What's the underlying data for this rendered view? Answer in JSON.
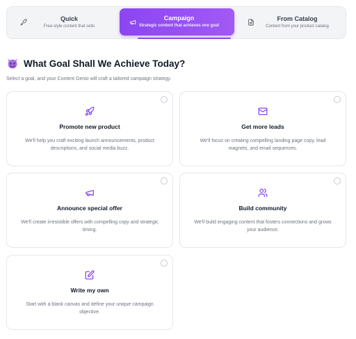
{
  "tabs": {
    "quick": {
      "title": "Quick",
      "subtitle": "Free-style content that sells",
      "icon": "rocket-icon"
    },
    "campaign": {
      "title": "Campaign",
      "subtitle": "Strategic content that achieves one goal",
      "icon": "megaphone-icon",
      "active": true
    },
    "catalog": {
      "title": "From Catalog",
      "subtitle": "Content from your product catalog",
      "icon": "document-icon"
    }
  },
  "heading": {
    "emoji": "smiling-devil-emoji",
    "title": "What Goal Shall We Achieve Today?",
    "subtitle": "Select a goal, and your Content Genio will craft a tailored campaign strategy."
  },
  "goals": [
    {
      "icon": "rocket-icon",
      "title": "Promote new product",
      "description": "We'll help you craft exciting launch announcements, product descriptions, and social media buzz.",
      "selected": false
    },
    {
      "icon": "mail-icon",
      "title": "Get more leads",
      "description": "We'll focus on creating compelling landing page copy, lead magnets, and email sequences.",
      "selected": false
    },
    {
      "icon": "megaphone-icon",
      "title": "Announce special offer",
      "description": "We'll create irresistible offers with compelling copy and strategic timing.",
      "selected": false
    },
    {
      "icon": "users-icon",
      "title": "Build community",
      "description": "We'll build engaging content that fosters connections and grows your audience.",
      "selected": false
    },
    {
      "icon": "pencil-square-icon",
      "title": "Write my own",
      "description": "Start with a blank canvas and define your unique campaign objective.",
      "selected": false
    }
  ],
  "colors": {
    "accent": "#8b46f0",
    "border": "#e5e7eb",
    "muted": "#6b7280",
    "tab_bg": "#f3f4f6"
  }
}
